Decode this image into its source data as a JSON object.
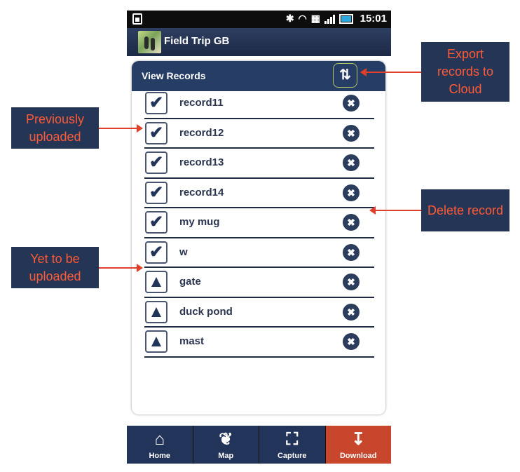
{
  "status_bar": {
    "time": "15:01",
    "icons": [
      "bluetooth-icon",
      "wifi-icon",
      "sim-icon",
      "signal-icon",
      "battery-icon"
    ]
  },
  "app": {
    "title": "Field Trip GB"
  },
  "panel": {
    "title": "View Records",
    "sync_icon": "sync-icon"
  },
  "records": [
    {
      "name": "record11",
      "status": "uploaded"
    },
    {
      "name": "record12",
      "status": "uploaded"
    },
    {
      "name": "record13",
      "status": "uploaded"
    },
    {
      "name": "record14",
      "status": "uploaded"
    },
    {
      "name": "my mug",
      "status": "uploaded"
    },
    {
      "name": "w",
      "status": "uploaded"
    },
    {
      "name": "gate",
      "status": "pending"
    },
    {
      "name": "duck pond",
      "status": "pending"
    },
    {
      "name": "mast",
      "status": "pending"
    }
  ],
  "tabs": [
    {
      "label": "Home",
      "icon": "home-icon"
    },
    {
      "label": "Map",
      "icon": "map-icon"
    },
    {
      "label": "Capture",
      "icon": "capture-icon"
    },
    {
      "label": "Download",
      "icon": "download-icon",
      "active": true
    }
  ],
  "callouts": {
    "export": "Export records to Cloud",
    "previous": "Previously uploaded",
    "delete": "Delete record",
    "pending": "Yet to be uploaded"
  },
  "colors": {
    "navy": "#263d66",
    "accent": "#c8462b",
    "callout_text": "#ff5a36"
  }
}
